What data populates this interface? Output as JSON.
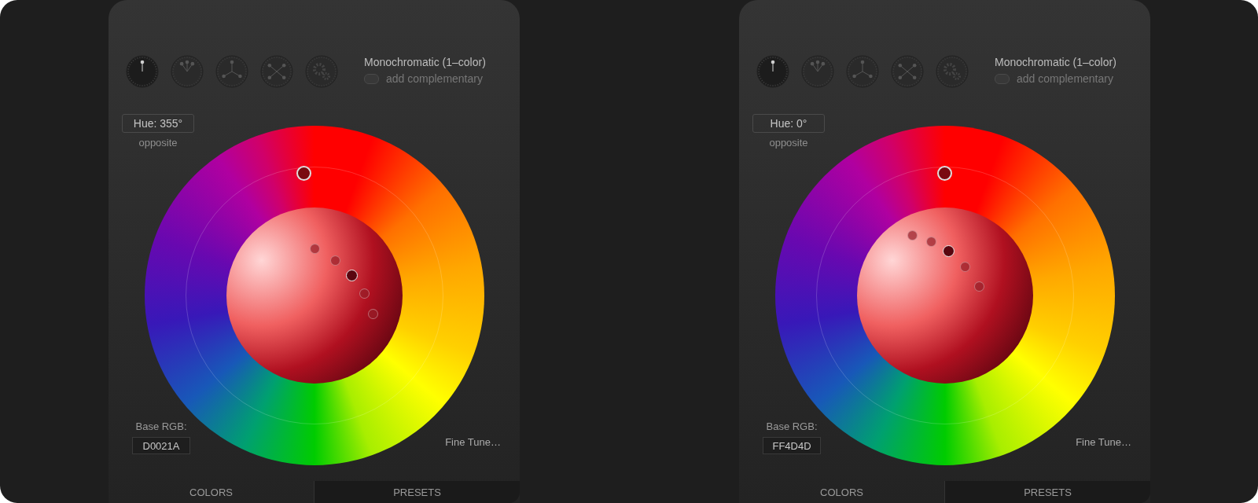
{
  "panels": [
    {
      "harmony_modes": [
        {
          "selected": true
        },
        {
          "selected": false
        },
        {
          "selected": false
        },
        {
          "selected": false
        },
        {
          "selected": false
        }
      ],
      "harmony_title": "Monochromatic (1–color)",
      "complementary": {
        "label": "add complementary",
        "on": false
      },
      "hue": "Hue: 355°",
      "hue_link": "opposite",
      "base_label": "Base RGB:",
      "base_value": "D0021A",
      "fine_tune": "Fine Tune…",
      "tabs": [
        {
          "label": "COLORS",
          "selected": true
        },
        {
          "label": "PRESETS",
          "selected": false
        }
      ]
    },
    {
      "harmony_modes": [
        {
          "selected": true
        },
        {
          "selected": false
        },
        {
          "selected": false
        },
        {
          "selected": false
        },
        {
          "selected": false
        }
      ],
      "harmony_title": "Monochromatic (1–color)",
      "complementary": {
        "label": "add complementary",
        "on": false
      },
      "hue": "Hue: 0°",
      "hue_link": "opposite",
      "base_label": "Base RGB:",
      "base_value": "FF4D4D",
      "fine_tune": "Fine Tune…",
      "tabs": [
        {
          "label": "COLORS",
          "selected": true
        },
        {
          "label": "PRESETS",
          "selected": false
        }
      ]
    }
  ]
}
